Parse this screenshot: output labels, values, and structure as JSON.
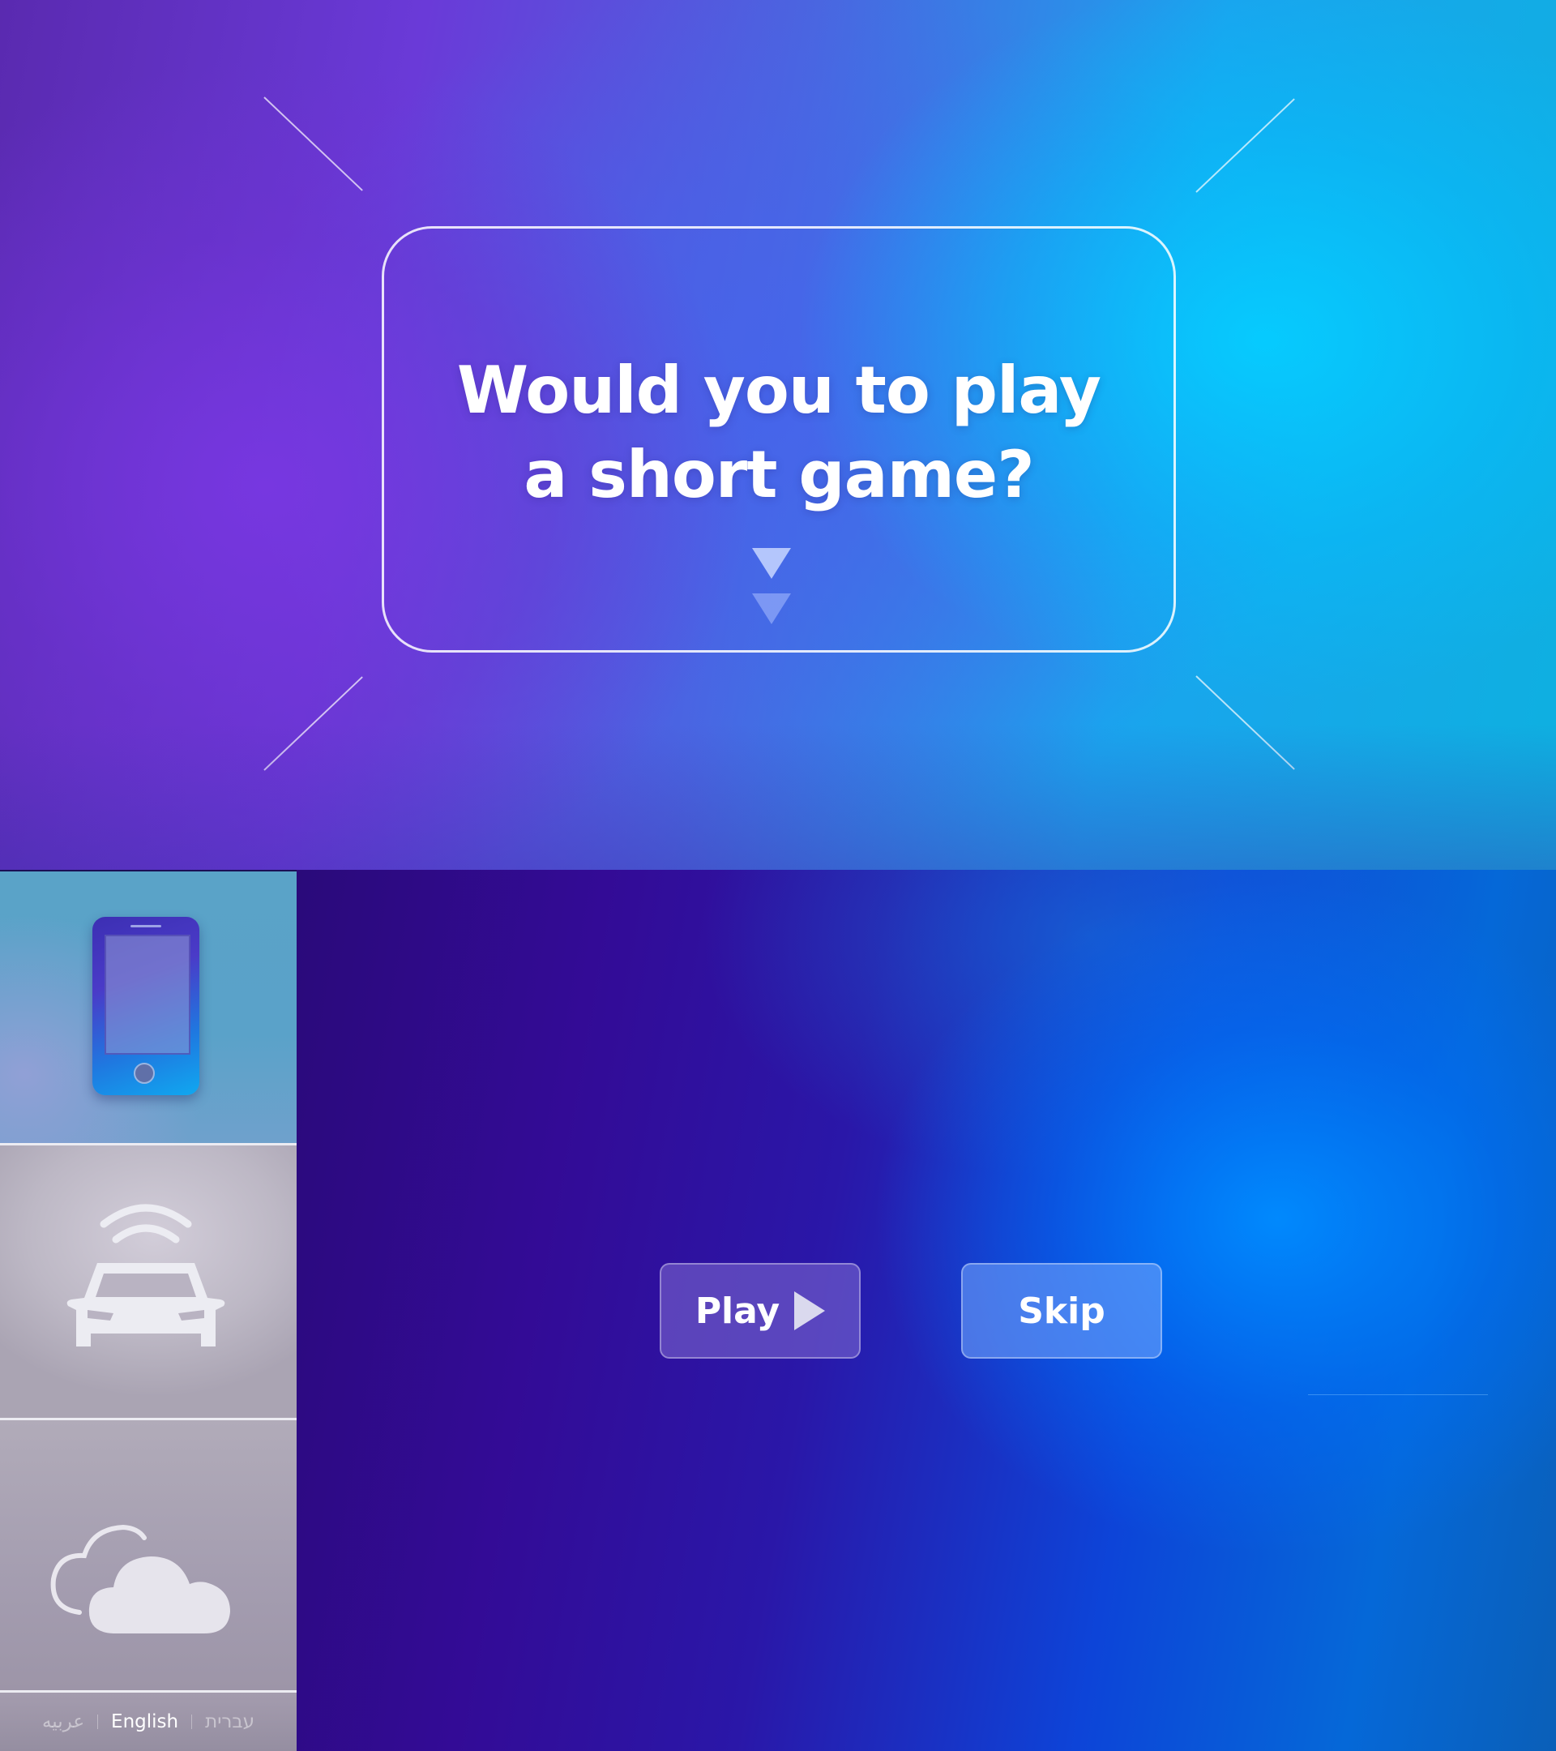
{
  "hero": {
    "question_line1": "Would you to play",
    "question_line2": "a short game?"
  },
  "sidebar": {
    "tiles": [
      {
        "icon": "phone-icon",
        "selected": true
      },
      {
        "icon": "connected-car-icon",
        "selected": false
      },
      {
        "icon": "cloud-icon",
        "selected": false
      }
    ],
    "languages": [
      {
        "label": "عربيه",
        "active": false
      },
      {
        "label": "English",
        "active": true
      },
      {
        "label": "עברית",
        "active": false
      }
    ]
  },
  "main": {
    "play_label": "Play",
    "skip_label": "Skip"
  },
  "colors": {
    "hero_left": "#6a3ad8",
    "hero_right": "#0ec4f6",
    "main_left": "#2a0a7a",
    "main_right": "#0080ff",
    "tile_selected": "#5aa3c8",
    "tile_inactive": "#b9b3c2"
  }
}
